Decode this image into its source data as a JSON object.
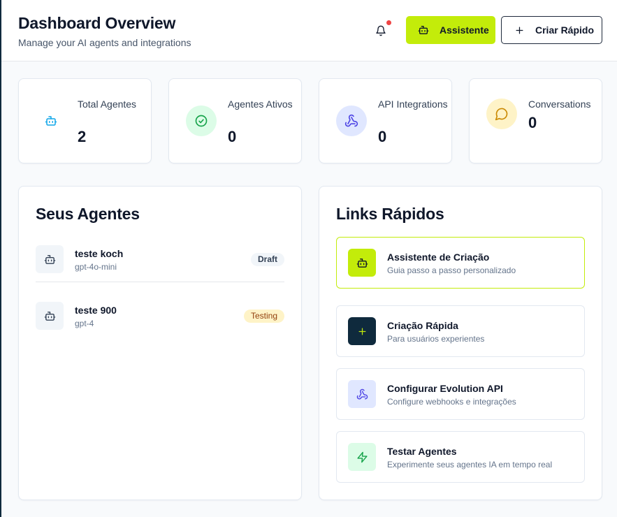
{
  "header": {
    "title": "Dashboard Overview",
    "subtitle": "Manage your AI agents and integrations",
    "assist_label": "Assistente",
    "quick_label": "Criar Rápido"
  },
  "stats": [
    {
      "label": "Total Agentes",
      "value": "2",
      "icon": "bot-icon"
    },
    {
      "label": "Agentes Ativos",
      "value": "0",
      "icon": "check-circle-icon"
    },
    {
      "label": "API Integrations",
      "value": "0",
      "icon": "webhook-icon"
    },
    {
      "label": "Conversations",
      "value": "0",
      "icon": "message-circle-icon"
    }
  ],
  "agents": {
    "title": "Seus Agentes",
    "items": [
      {
        "name": "teste koch",
        "model": "gpt-4o-mini",
        "status": "Draft"
      },
      {
        "name": "teste 900",
        "model": "gpt-4",
        "status": "Testing"
      }
    ]
  },
  "links": {
    "title": "Links Rápidos",
    "items": [
      {
        "title": "Assistente de Criação",
        "desc": "Guia passo a passo personalizado",
        "icon": "bot-icon"
      },
      {
        "title": "Criação Rápida",
        "desc": "Para usuários experientes",
        "icon": "plus-icon"
      },
      {
        "title": "Configurar Evolution API",
        "desc": "Configure webhooks e integrações",
        "icon": "webhook-icon"
      },
      {
        "title": "Testar Agentes",
        "desc": "Experimente seus agentes IA em tempo real",
        "icon": "zap-icon"
      }
    ]
  },
  "colors": {
    "accent": "#c3ec0a",
    "dark": "#0f2a3d",
    "notification": "#ef4444"
  }
}
